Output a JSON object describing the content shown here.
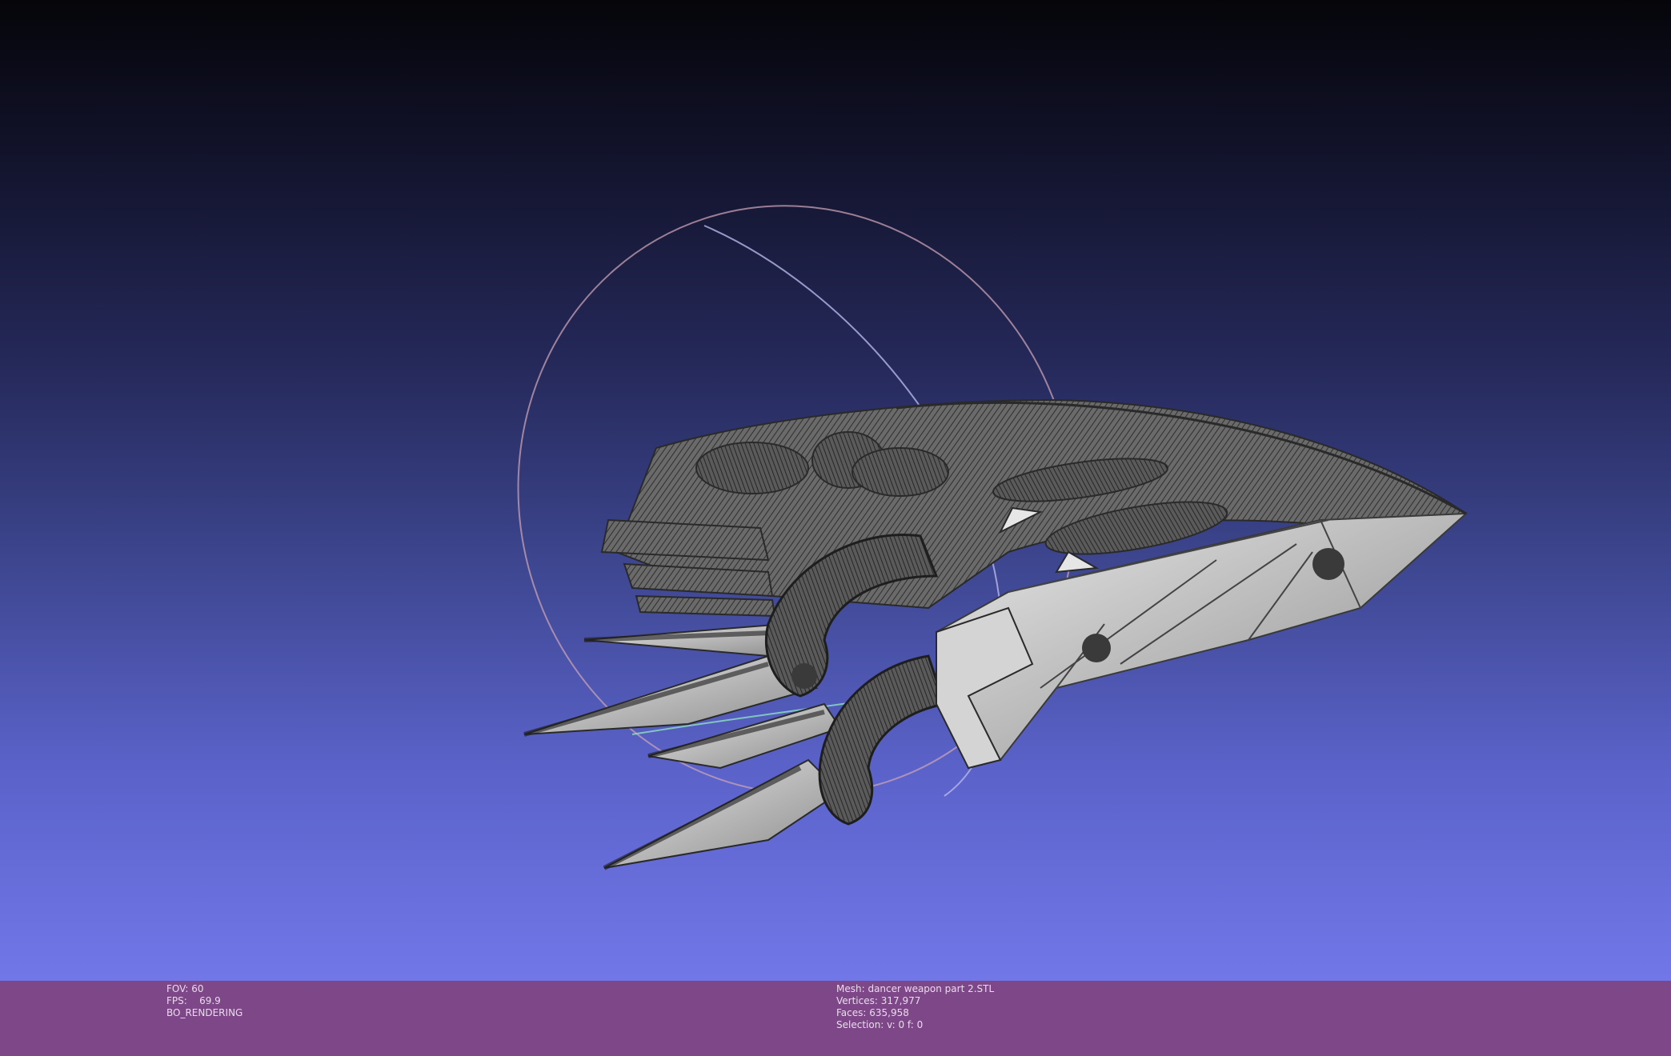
{
  "render_info": {
    "fov": "FOV: 60",
    "fps_label": "FPS:",
    "fps_value": "69.9",
    "mode": "BO_RENDERING"
  },
  "mesh_info": {
    "mesh": "Mesh: dancer weapon part 2.STL",
    "vertices": "Vertices: 317,977",
    "faces": "Faces: 635,958",
    "selection": "Selection: v: 0 f: 0"
  },
  "colors": {
    "status_bar": "#7e4888",
    "background_top": "#05050a",
    "background_bottom": "#7277e8",
    "mesh_fill": "#bdbdbd",
    "mesh_wire": "#3c3c3c"
  }
}
